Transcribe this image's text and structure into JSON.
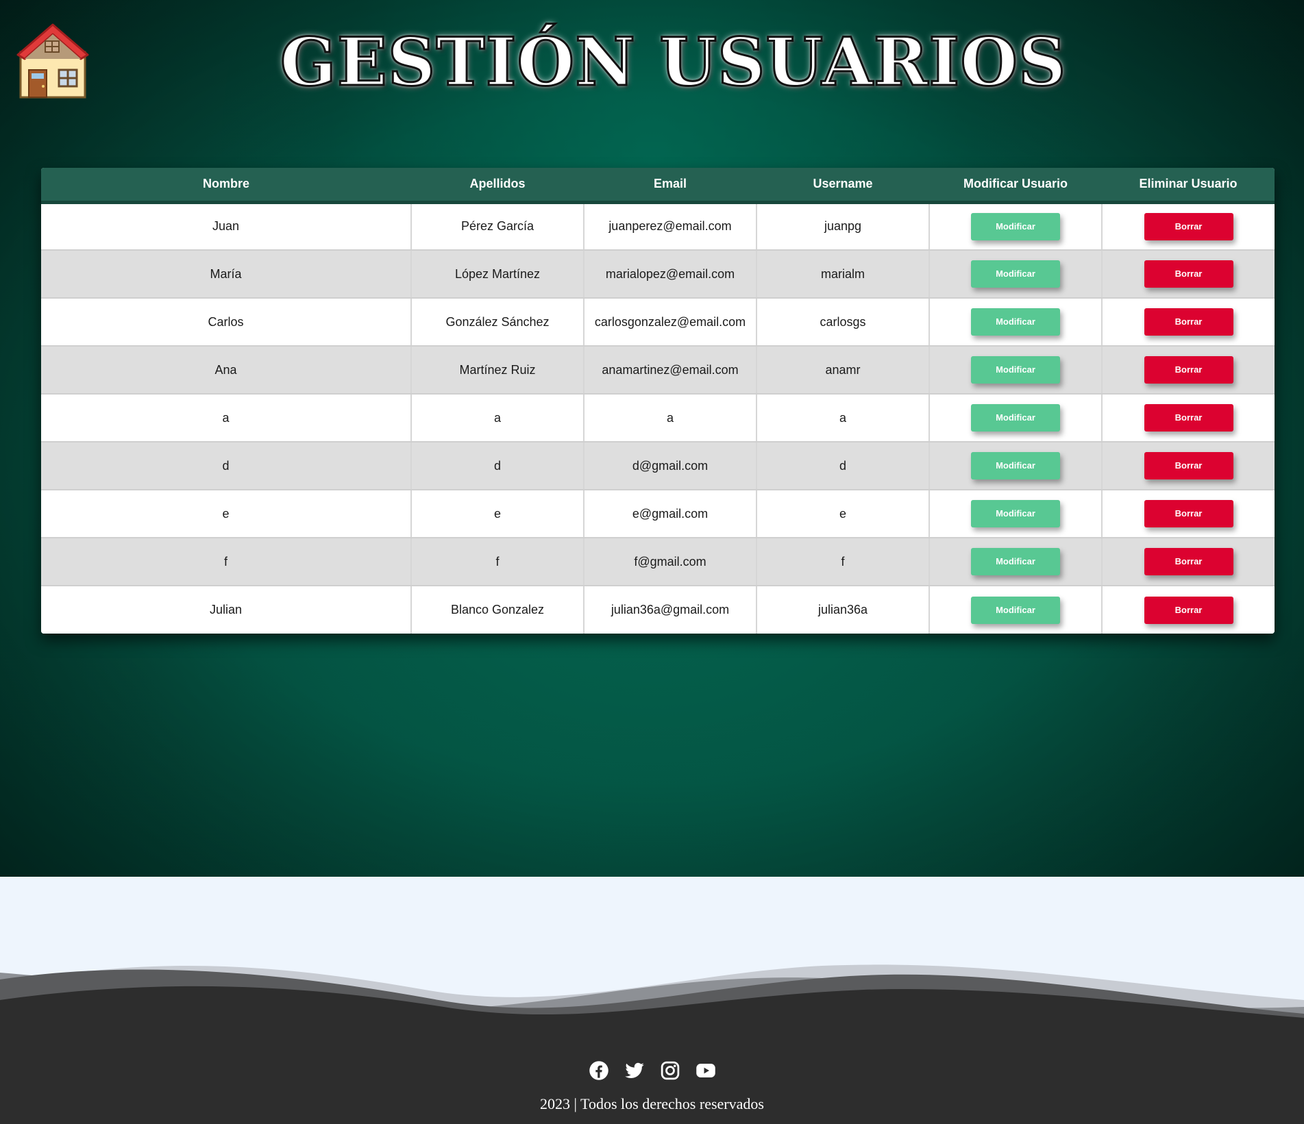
{
  "header": {
    "title": "GESTIÓN USUARIOS",
    "home_icon": "house-icon"
  },
  "table": {
    "columns": [
      "Nombre",
      "Apellidos",
      "Email",
      "Username",
      "Modificar Usuario",
      "Eliminar Usuario"
    ],
    "modify_label": "Modificar",
    "delete_label": "Borrar",
    "rows": [
      [
        "Juan",
        "Pérez García",
        "juanperez@email.com",
        "juanpg"
      ],
      [
        "María",
        "López Martínez",
        "marialopez@email.com",
        "marialm"
      ],
      [
        "Carlos",
        "González Sánchez",
        "carlosgonzalez@email.com",
        "carlosgs"
      ],
      [
        "Ana",
        "Martínez Ruiz",
        "anamartinez@email.com",
        "anamr"
      ],
      [
        "a",
        "a",
        "a",
        "a"
      ],
      [
        "d",
        "d",
        "d@gmail.com",
        "d"
      ],
      [
        "e",
        "e",
        "e@gmail.com",
        "e"
      ],
      [
        "f",
        "f",
        "f@gmail.com",
        "f"
      ],
      [
        "Julian",
        "Blanco Gonzalez",
        "julian36a@gmail.com",
        "julian36a"
      ]
    ]
  },
  "footer": {
    "social_icons": [
      "facebook-icon",
      "twitter-icon",
      "instagram-icon",
      "youtube-icon"
    ],
    "copyright": "2023 | Todos los derechos reservados"
  },
  "colors": {
    "header_row": "#256152",
    "modify_button": "#58c893",
    "delete_button": "#dc0230",
    "footer": "#2d2d2d"
  }
}
